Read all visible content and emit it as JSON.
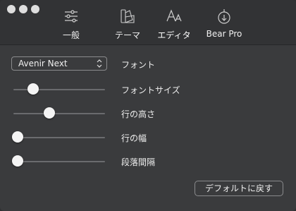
{
  "toolbar": {
    "tabs": [
      {
        "label": "一般",
        "icon": "sliders-icon"
      },
      {
        "label": "テーマ",
        "icon": "palette-swatches-icon"
      },
      {
        "label": "エディタ",
        "icon": "font-aa-icon"
      },
      {
        "label": "Bear Pro",
        "icon": "bear-pro-icon"
      }
    ],
    "active_tab": "エディタ"
  },
  "editor": {
    "font_value": "Avenir Next",
    "font_label": "フォント",
    "font_size_label": "フォントサイズ",
    "line_height_label": "行の高さ",
    "line_width_label": "行の幅",
    "paragraph_spacing_label": "段落間隔",
    "reset_button": "デフォルトに戻す"
  },
  "sliders": {
    "font_size": 0.19,
    "line_height": 0.38,
    "line_width": 0.0,
    "paragraph_spacing": 0.0
  }
}
